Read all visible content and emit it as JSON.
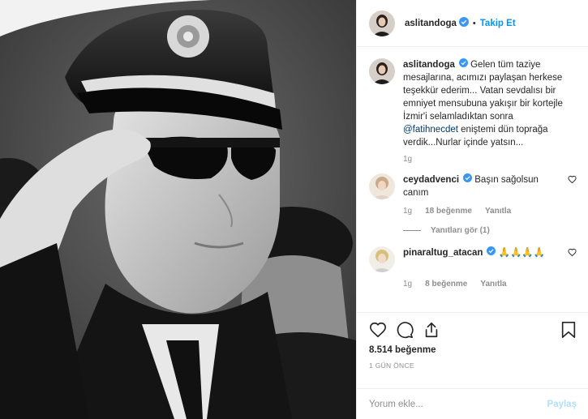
{
  "header": {
    "username": "aslitandoga",
    "dot": "•",
    "follow_label": "Takip Et"
  },
  "caption": {
    "username": "aslitandoga",
    "text_before": "Gelen tüm taziye mesajlarına, acımızı paylaşan herkese teşekkür ederim... Vatan sevdalısı bir emniyet mensubuna yakışır bir kortejle İzmir'i selamladıktan sonra ",
    "mention": "@fatihnecdet",
    "text_after": " eniştemi dün toprağa verdik...Nurlar içinde yatsın...",
    "time": "1g"
  },
  "comments": [
    {
      "username": "ceydadvenci",
      "text": "Başın sağolsun canım",
      "time": "1g",
      "likes": "18 beğenme",
      "reply": "Yanıtla",
      "view_replies": "Yanıtları gör (1)"
    },
    {
      "username": "pinaraltug_atacan",
      "text": "🙏🙏🙏🙏",
      "time": "1g",
      "likes": "8 beğenme",
      "reply": "Yanıtla"
    }
  ],
  "actions": {
    "likes": "8.514 beğenme",
    "time_ago": "1 GÜN ÖNCE"
  },
  "add_comment": {
    "placeholder": "Yorum ekle...",
    "post_label": "Paylaş"
  },
  "colors": {
    "accent": "#0095f6",
    "verified": "#3897f0",
    "muted": "#8e8e8e"
  }
}
